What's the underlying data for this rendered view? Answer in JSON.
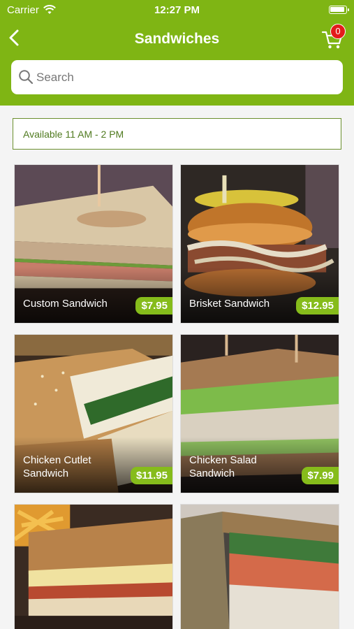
{
  "status_bar": {
    "carrier": "Carrier",
    "time": "12:27 PM"
  },
  "header": {
    "title": "Sandwiches",
    "cart_count": "0"
  },
  "search": {
    "placeholder": "Search"
  },
  "availability": "Available 11 AM - 2 PM",
  "items": [
    {
      "name": "Custom Sandwich",
      "price": "$7.95"
    },
    {
      "name": "Brisket Sandwich",
      "price": "$12.95"
    },
    {
      "name": "Chicken Cutlet Sandwich",
      "price": "$11.95"
    },
    {
      "name": "Chicken Salad Sandwich",
      "price": "$7.99"
    },
    {
      "name": "",
      "price": ""
    },
    {
      "name": "",
      "price": ""
    }
  ],
  "colors": {
    "brand_green": "#7fb514",
    "badge_red": "#e31b1b"
  }
}
